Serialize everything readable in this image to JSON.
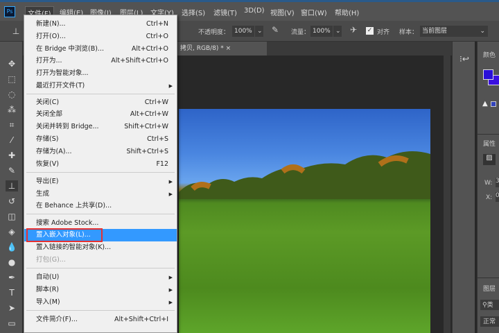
{
  "app": {
    "logo": "Ps"
  },
  "menubar": [
    "文件(F)",
    "编辑(E)",
    "图像(I)",
    "图层(L)",
    "文字(Y)",
    "选择(S)",
    "滤镜(T)",
    "3D(D)",
    "视图(V)",
    "窗口(W)",
    "帮助(H)"
  ],
  "options": {
    "opacity_label": "不透明度：",
    "opacity": "100%",
    "flow_label": "流量：",
    "flow": "100%",
    "align_label": "对齐",
    "align_checked": true,
    "sample_label": "样本：",
    "sample_value": "当前图层"
  },
  "tab": {
    "title": "拷贝, RGB/8) *",
    "close": "×"
  },
  "file_menu": [
    {
      "label": "新建(N)...",
      "shortcut": "Ctrl+N"
    },
    {
      "label": "打开(O)...",
      "shortcut": "Ctrl+O"
    },
    {
      "label": "在 Bridge 中浏览(B)...",
      "shortcut": "Alt+Ctrl+O"
    },
    {
      "label": "打开为...",
      "shortcut": "Alt+Shift+Ctrl+O"
    },
    {
      "label": "打开为智能对象...",
      "shortcut": ""
    },
    {
      "label": "最近打开文件(T)",
      "shortcut": "",
      "submenu": true
    },
    {
      "label": "关闭(C)",
      "shortcut": "Ctrl+W"
    },
    {
      "label": "关闭全部",
      "shortcut": "Alt+Ctrl+W"
    },
    {
      "label": "关闭并转到 Bridge...",
      "shortcut": "Shift+Ctrl+W"
    },
    {
      "label": "存储(S)",
      "shortcut": "Ctrl+S"
    },
    {
      "label": "存储为(A)...",
      "shortcut": "Shift+Ctrl+S"
    },
    {
      "label": "恢复(V)",
      "shortcut": "F12"
    },
    {
      "label": "导出(E)",
      "shortcut": "",
      "submenu": true
    },
    {
      "label": "生成",
      "shortcut": "",
      "submenu": true
    },
    {
      "label": "在 Behance 上共享(D)...",
      "shortcut": ""
    },
    {
      "label": "搜索 Adobe Stock...",
      "shortcut": ""
    },
    {
      "label": "置入嵌入对象(L)...",
      "shortcut": "",
      "highlighted": true
    },
    {
      "label": "置入链接的智能对象(K)...",
      "shortcut": ""
    },
    {
      "label": "打包(G)...",
      "shortcut": "",
      "disabled": true
    },
    {
      "label": "自动(U)",
      "shortcut": "",
      "submenu": true
    },
    {
      "label": "脚本(R)",
      "shortcut": "",
      "submenu": true
    },
    {
      "label": "导入(M)",
      "shortcut": "",
      "submenu": true
    },
    {
      "label": "文件简介(F)...",
      "shortcut": "Alt+Shift+Ctrl+I"
    }
  ],
  "right_panel": {
    "color_title": "颜色",
    "fg_color": "#2a10d8",
    "bg_color": "#3a10e0",
    "properties_title": "属性",
    "w_label": "W:",
    "w_value": "3",
    "x_label": "X:",
    "x_value": "0",
    "layers_title": "图层",
    "layers_search": "类",
    "blend_mode": "正常"
  }
}
